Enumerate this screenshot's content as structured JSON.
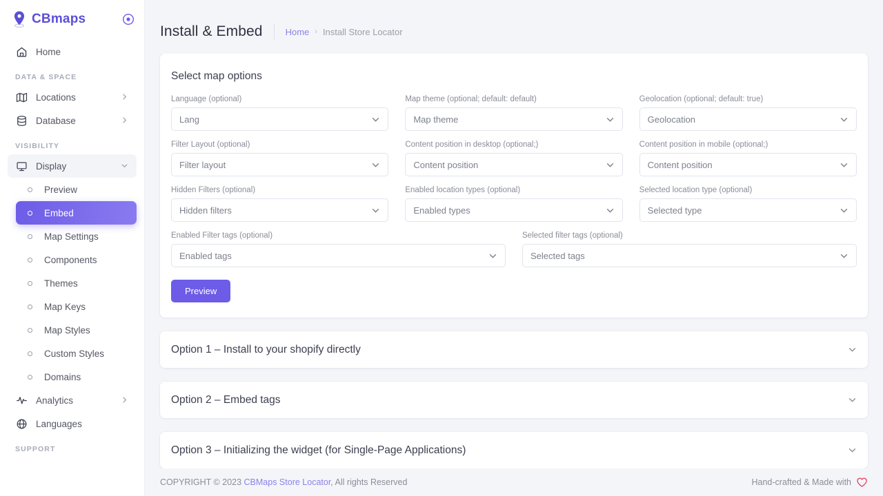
{
  "brand": {
    "name": "CBmaps",
    "logo_icon": "map-pin-icon",
    "target_icon": "target-icon",
    "accent": "#6c5ce7"
  },
  "sidebar": {
    "home": {
      "label": "Home",
      "icon": "home-icon"
    },
    "sections": [
      {
        "label": "DATA & SPACE",
        "items": [
          {
            "label": "Locations",
            "icon": "map-icon",
            "expandable": true
          },
          {
            "label": "Database",
            "icon": "database-icon",
            "expandable": true
          }
        ]
      },
      {
        "label": "VISIBILITY",
        "items": [
          {
            "label": "Display",
            "icon": "monitor-icon",
            "expandable": true,
            "state": "hovered"
          },
          {
            "label": "Preview",
            "icon": "circle-marker-icon",
            "sub": true
          },
          {
            "label": "Embed",
            "icon": "circle-marker-icon",
            "sub": true,
            "state": "active"
          },
          {
            "label": "Map Settings",
            "icon": "circle-marker-icon",
            "sub": true
          },
          {
            "label": "Components",
            "icon": "circle-marker-icon",
            "sub": true
          },
          {
            "label": "Themes",
            "icon": "circle-marker-icon",
            "sub": true
          },
          {
            "label": "Map Keys",
            "icon": "circle-marker-icon",
            "sub": true
          },
          {
            "label": "Map Styles",
            "icon": "circle-marker-icon",
            "sub": true
          },
          {
            "label": "Custom Styles",
            "icon": "circle-marker-icon",
            "sub": true
          },
          {
            "label": "Domains",
            "icon": "circle-marker-icon",
            "sub": true
          },
          {
            "label": "Analytics",
            "icon": "analytics-icon",
            "expandable": true
          },
          {
            "label": "Languages",
            "icon": "globe-icon"
          }
        ]
      },
      {
        "label": "SUPPORT",
        "items": []
      }
    ]
  },
  "header": {
    "title": "Install & Embed",
    "breadcrumb": {
      "home": "Home",
      "separator": "›",
      "current": "Install Store Locator"
    }
  },
  "options_card": {
    "title": "Select map options",
    "fields": [
      {
        "label": "Language (optional)",
        "value": "Lang"
      },
      {
        "label": "Map theme (optional; default: default)",
        "value": "Map theme"
      },
      {
        "label": "Geolocation (optional; default: true)",
        "value": "Geolocation"
      },
      {
        "label": "Filter Layout (optional)",
        "value": "Filter layout"
      },
      {
        "label": "Content position in desktop (optional;)",
        "value": "Content position"
      },
      {
        "label": "Content position in mobile (optional;)",
        "value": "Content position"
      },
      {
        "label": "Hidden Filters (optional)",
        "value": "Hidden filters"
      },
      {
        "label": "Enabled location types (optional)",
        "value": "Enabled types"
      },
      {
        "label": "Selected location type (optional)",
        "value": "Selected type"
      }
    ],
    "fields_wide": [
      {
        "label": "Enabled Filter tags (optional)",
        "value": "Enabled tags"
      },
      {
        "label": "Selected filter tags (optional)",
        "value": "Selected tags"
      }
    ],
    "preview_button": "Preview"
  },
  "accordions": [
    {
      "title": "Option 1 – Install to your shopify directly",
      "icon": "chevron-down-icon"
    },
    {
      "title": "Option 2 – Embed tags",
      "icon": "chevron-down-icon"
    },
    {
      "title": "Option 3 – Initializing the widget (for Single-Page Applications)",
      "icon": "chevron-down-icon"
    }
  ],
  "footer": {
    "copyright_prefix": "COPYRIGHT © 2023 ",
    "link": "CBMaps Store Locator",
    "copyright_suffix": ", All rights Reserved",
    "right_text": "Hand-crafted & Made with",
    "heart_icon": "heart-icon",
    "heart_color": "#e1475f"
  }
}
